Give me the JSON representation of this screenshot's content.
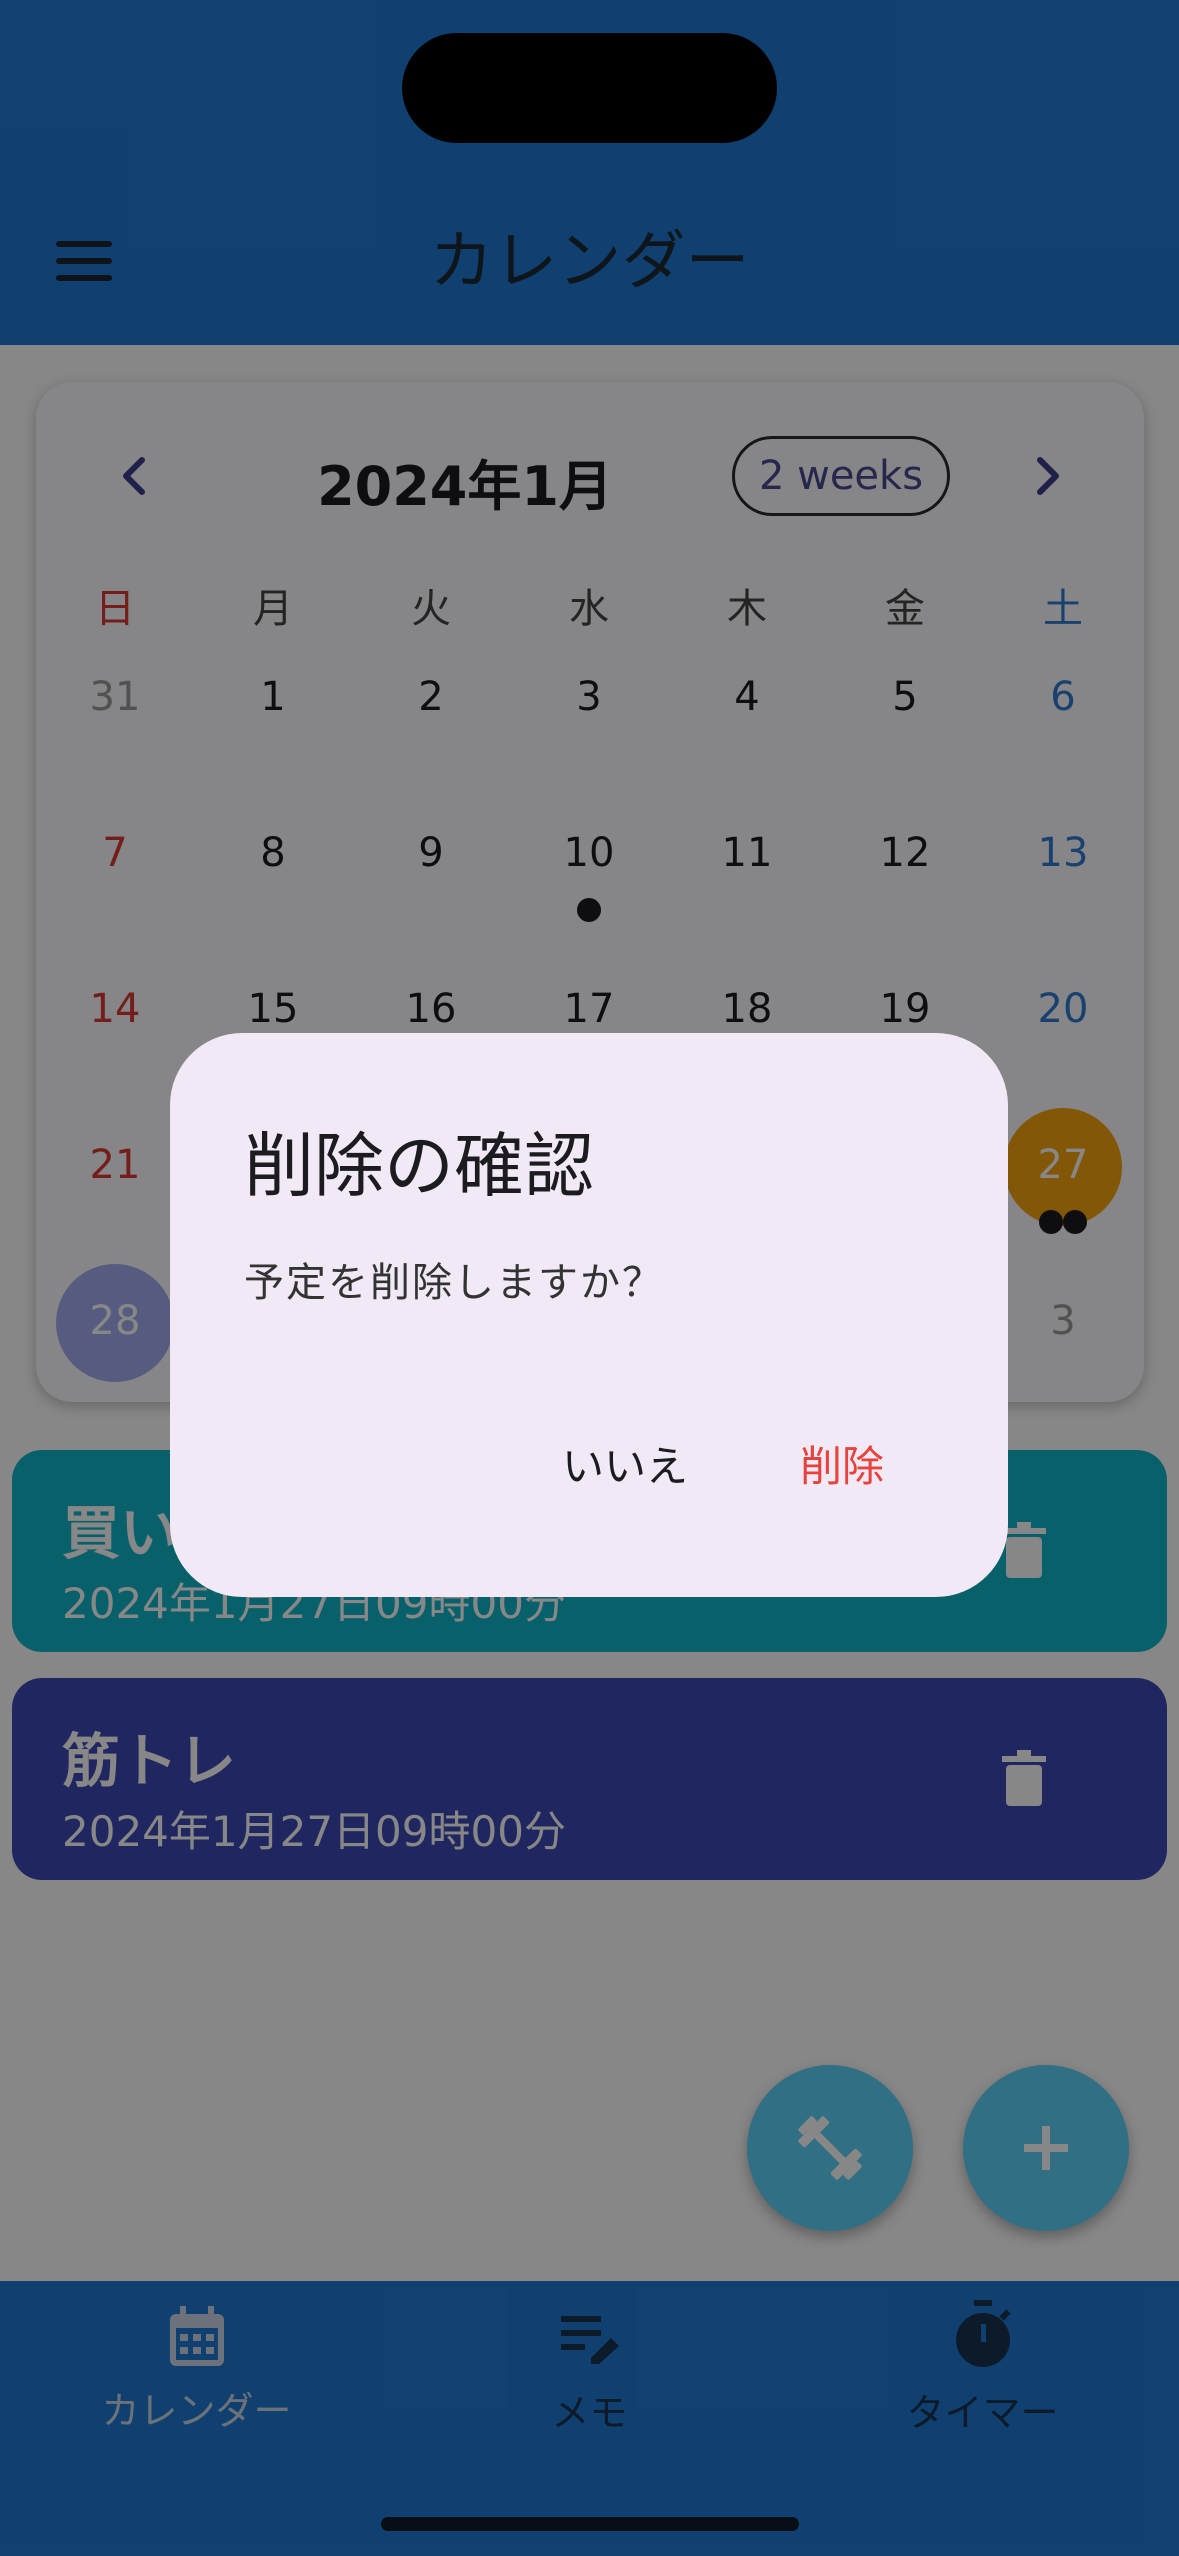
{
  "app_bar": {
    "title": "カレンダー",
    "menu_icon": "menu-icon"
  },
  "calendar": {
    "month_title": "2024年1月",
    "format_button": "2 weeks",
    "prev_icon": "chevron-left-icon",
    "next_icon": "chevron-right-icon",
    "weekdays": [
      "日",
      "月",
      "火",
      "水",
      "木",
      "金",
      "土"
    ],
    "weeks": [
      [
        "31",
        "1",
        "2",
        "3",
        "4",
        "5",
        "6"
      ],
      [
        "7",
        "8",
        "9",
        "10",
        "11",
        "12",
        "13"
      ],
      [
        "14",
        "15",
        "16",
        "17",
        "18",
        "19",
        "20"
      ],
      [
        "21",
        "",
        "",
        "",
        "",
        "",
        "27"
      ],
      [
        "28",
        "",
        "",
        "",
        "",
        "",
        "3"
      ]
    ],
    "selected_day": "27",
    "today": "28",
    "colors": {
      "sunday": "#d93a33",
      "saturday": "#2f7cd0",
      "selected": "#f5a40f",
      "today": "#a3aff0"
    }
  },
  "events": [
    {
      "title": "買い",
      "time": "2024年1月27日09時00分",
      "color": "#0fb6c8"
    },
    {
      "title": "筋トレ",
      "time": "2024年1月27日09時00分",
      "color": "#3d4ab5"
    }
  ],
  "fabs": [
    {
      "name": "workout-fab",
      "icon": "dumbbell-icon"
    },
    {
      "name": "add-fab",
      "icon": "plus-icon"
    }
  ],
  "bottom_nav": [
    {
      "label": "カレンダー",
      "icon": "calendar-icon"
    },
    {
      "label": "メモ",
      "icon": "memo-edit-icon"
    },
    {
      "label": "タイマー",
      "icon": "stopwatch-icon"
    }
  ],
  "dialog": {
    "title": "削除の確認",
    "message": "予定を削除しますか？",
    "cancel_label": "いいえ",
    "confirm_label": "削除",
    "confirm_color": "#e8423c"
  }
}
